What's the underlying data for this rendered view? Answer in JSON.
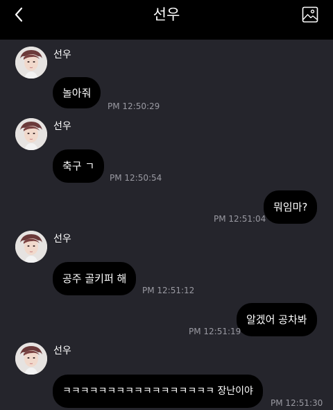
{
  "header": {
    "title": "선우",
    "back_icon": "chevron-left-icon",
    "gallery_icon": "image-icon"
  },
  "colors": {
    "header_bg": "#000000",
    "chat_bg": "#25252c",
    "bubble_bg": "#000000",
    "text": "#ffffff",
    "timestamp": "#9a9aa2"
  },
  "messages": [
    {
      "direction": "incoming",
      "sender": "선우",
      "text": "놀아줘",
      "time": "PM 12:50:29"
    },
    {
      "direction": "incoming",
      "sender": "선우",
      "text": "축구 ㄱ",
      "time": "PM 12:50:54"
    },
    {
      "direction": "outgoing",
      "text": "뭐임마?",
      "time": "PM 12:51:04"
    },
    {
      "direction": "incoming",
      "sender": "선우",
      "text": "공주 골키퍼 해",
      "time": "PM 12:51:12"
    },
    {
      "direction": "outgoing",
      "text": "알겠어 공차봐",
      "time": "PM 12:51:19"
    },
    {
      "direction": "incoming",
      "sender": "선우",
      "text": "ㅋㅋㅋㅋㅋㅋㅋㅋㅋㅋㅋㅋㅋㅋㅋㅋㅋ 장난이야",
      "time": "PM 12:51:30"
    }
  ]
}
